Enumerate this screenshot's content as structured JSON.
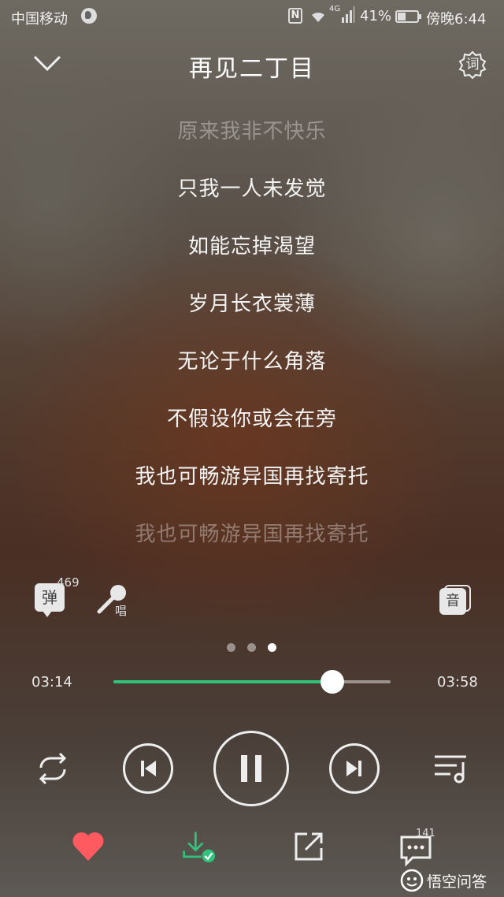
{
  "status_bar": {
    "carrier": "中国移动",
    "network": "4G",
    "battery_percent": "41%",
    "battery_level": 0.41,
    "time": "傍晚6:44"
  },
  "header": {
    "title": "再见二丁目",
    "lyric_button_label": "词"
  },
  "lyrics": [
    {
      "text": "原来我非不快乐",
      "dim": true
    },
    {
      "text": "只我一人未发觉",
      "dim": false
    },
    {
      "text": "如能忘掉渴望",
      "dim": false
    },
    {
      "text": "岁月长衣裳薄",
      "dim": false
    },
    {
      "text": "无论于什么角落",
      "dim": false
    },
    {
      "text": "不假设你或会在旁",
      "dim": false
    },
    {
      "text": "我也可畅游异国再找寄托",
      "dim": false
    },
    {
      "text": "我也可畅游异国再找寄托",
      "dim": true
    }
  ],
  "actions": {
    "danmu_label": "弹",
    "danmu_count": "469",
    "sing_label": "唱",
    "quality_label": "音"
  },
  "pager": {
    "count": 3,
    "active": 2
  },
  "progress": {
    "current": "03:14",
    "total": "03:58",
    "fraction": 0.79
  },
  "controls": {
    "repeat_icon": "repeat-icon",
    "prev_icon": "skip-previous-icon",
    "play_state": "pause-icon",
    "next_icon": "skip-next-icon",
    "playlist_icon": "playlist-icon"
  },
  "bottom": {
    "favorite_icon": "heart-icon",
    "favorite_color": "#ff5a5f",
    "download_icon": "download-icon",
    "download_color": "#31c27c",
    "share_icon": "share-icon",
    "comment_icon": "comment-icon",
    "comment_count": "141"
  },
  "watermark": "悟空问答"
}
